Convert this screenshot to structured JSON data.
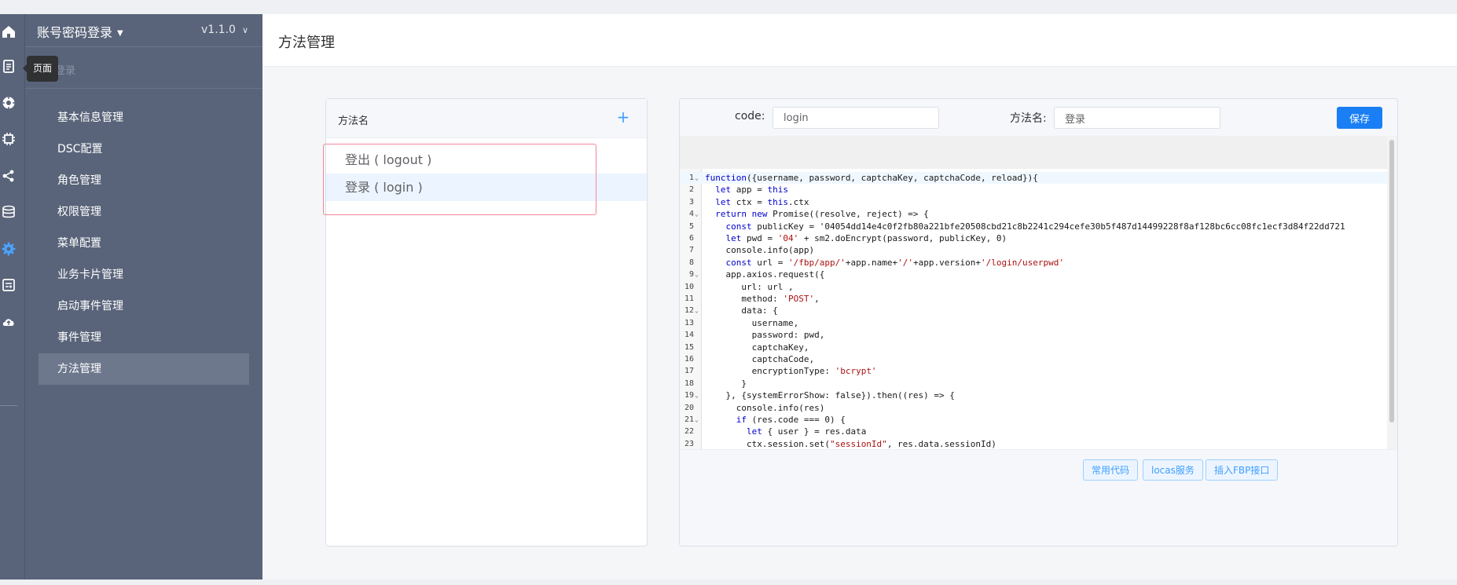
{
  "sidebar": {
    "login_mode": "账号密码登录",
    "version": "v1.1.0",
    "sub_label": "登录",
    "tooltip": "页面",
    "items": [
      {
        "label": "基本信息管理"
      },
      {
        "label": "DSC配置"
      },
      {
        "label": "角色管理"
      },
      {
        "label": "权限管理"
      },
      {
        "label": "菜单配置"
      },
      {
        "label": "业务卡片管理"
      },
      {
        "label": "启动事件管理"
      },
      {
        "label": "事件管理"
      },
      {
        "label": "方法管理"
      }
    ],
    "active_item": "方法管理"
  },
  "rail_icons": [
    "home-icon",
    "pages-icon",
    "target-icon",
    "chip-icon",
    "share-icon",
    "database-icon",
    "gear-icon",
    "report-icon",
    "cloud-upload-icon"
  ],
  "page": {
    "title": "方法管理"
  },
  "method_list": {
    "header": "方法名",
    "add_symbol": "+",
    "methods": [
      {
        "label": "登出 ( logout )"
      },
      {
        "label": "登录 ( login )"
      }
    ],
    "selected": "登录 ( login )"
  },
  "editor": {
    "code_label": "code:",
    "code_value": "login",
    "name_label": "方法名:",
    "name_value": "登录",
    "save_label": "保存",
    "lines": [
      "function({username, password, captchaKey, captchaCode, reload}){",
      "  let app = this",
      "  let ctx = this.ctx",
      "  return new Promise((resolve, reject) => {",
      "    const publicKey = '04054dd14e4c0f2fb80a221bfe20508cbd21c8b2241c294cefe30b5f487d14499228f8af128bc6cc08fc1ecf3d84f22dd721",
      "    let pwd = '04' + sm2.doEncrypt(password, publicKey, 0)",
      "    console.info(app)",
      "    const url = '/fbp/app/'+app.name+'/'+app.version+'/login/userpwd'",
      "    app.axios.request({",
      "       url: url ,",
      "       method: 'POST',",
      "       data: {",
      "         username,",
      "         password: pwd,",
      "         captchaKey,",
      "         captchaCode,",
      "         encryptionType: 'bcrypt'",
      "       }",
      "    }, {systemErrorShow: false}).then((res) => {",
      "      console.info(res)",
      "      if (res.code === 0) {",
      "        let { user } = res.data",
      "        ctx.session.set(\"sessionId\", res.data.sessionId)"
    ],
    "fold_lines": [
      1,
      4,
      9,
      12,
      19,
      21
    ],
    "footer_buttons": [
      {
        "label": "常用代码"
      },
      {
        "label": "locas服务"
      },
      {
        "label": "插入FBP接口"
      }
    ]
  }
}
